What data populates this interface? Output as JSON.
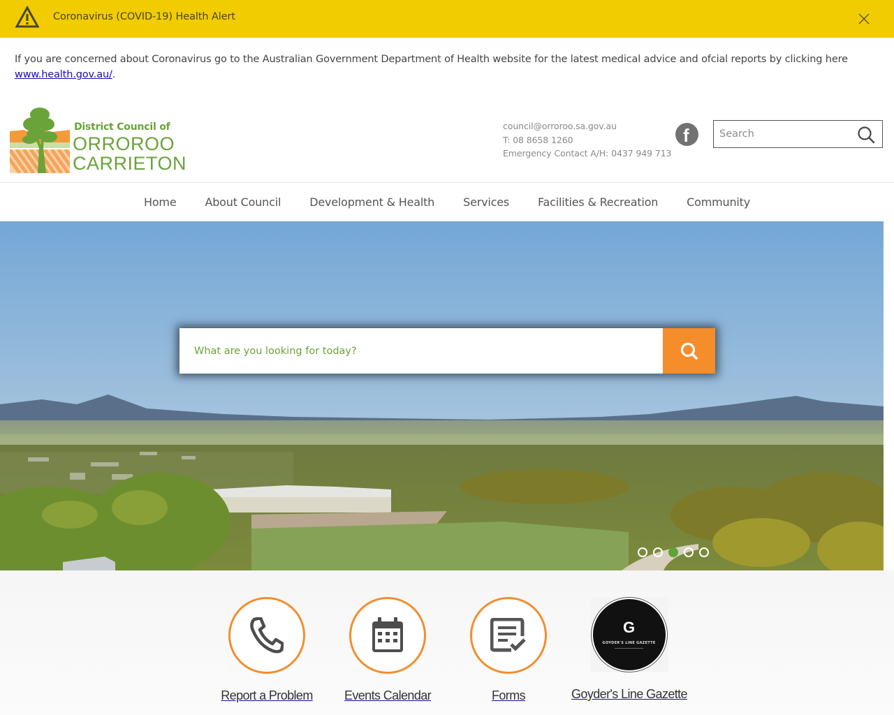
{
  "alert": {
    "title": "Coronavirus (COVID-19) Health Alert",
    "icon": "warning-triangle-icon",
    "close_icon": "close-icon",
    "body_text": "If you are concerned about Coronavirus go to the Australian Government Department of Health website for the latest medical advice and ofcial reports by clicking here ",
    "link_text": "www.health.gov.au/",
    "trailing": "."
  },
  "logo": {
    "line1": "District Council of",
    "line2": "ORROROO",
    "line3": "CARRIETON"
  },
  "contact": {
    "email": "council@orroroo.sa.gov.au",
    "phone": "T: 08 8658 1260",
    "emergency": "Emergency Contact A/H: 0437 949 713"
  },
  "header_search": {
    "placeholder": "Search",
    "value": ""
  },
  "nav": {
    "items": [
      {
        "label": "Home"
      },
      {
        "label": "About Council"
      },
      {
        "label": "Development & Health"
      },
      {
        "label": "Services"
      },
      {
        "label": "Facilities & Recreation"
      },
      {
        "label": "Community"
      }
    ]
  },
  "hero": {
    "search_placeholder": "What are you looking for today?",
    "search_value": "",
    "slides_count": 5,
    "active_slide": 3
  },
  "quick_links": [
    {
      "label": "Report a Problem",
      "icon": "phone-icon"
    },
    {
      "label": "Events Calendar",
      "icon": "calendar-icon"
    },
    {
      "label": "Forms",
      "icon": "form-check-icon"
    },
    {
      "label": "Goyder's Line Gazette",
      "icon": "gazette-logo",
      "logo_letter": "G",
      "logo_text": "GOYDER'S LINE GAZETTE"
    }
  ],
  "colors": {
    "alert_bg": "#f0cc00",
    "brand_green": "#6aa33a",
    "accent_orange": "#f58d2b",
    "link_blue": "#1a0dab"
  }
}
